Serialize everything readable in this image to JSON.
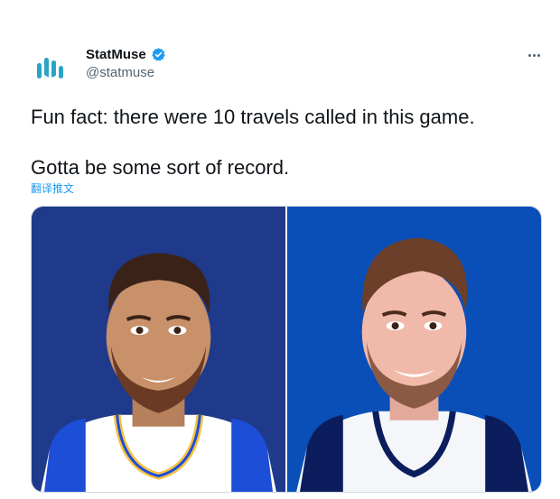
{
  "author": {
    "display_name": "StatMuse",
    "handle": "@statmuse",
    "verified": true,
    "avatar_icon": "statmuse-logo-icon"
  },
  "tweet": {
    "lines": [
      "Fun fact: there were 10 travels called in this game.",
      "Gotta be some sort of record."
    ],
    "translate_label": "翻译推文"
  },
  "media": {
    "images": [
      {
        "icon": "player-illustration-icon",
        "background": "#1f3a8a",
        "jersey": "#ffffff",
        "trim": "#f6c244"
      },
      {
        "icon": "player-illustration-icon",
        "background": "#0a4fb8",
        "jersey": "#ffffff",
        "trim": "#0b1d5c"
      }
    ]
  },
  "colors": {
    "link": "#1d9bf0",
    "verified": "#1d9bf0",
    "secondary_text": "#536471",
    "logo": "#2aa4c5"
  }
}
